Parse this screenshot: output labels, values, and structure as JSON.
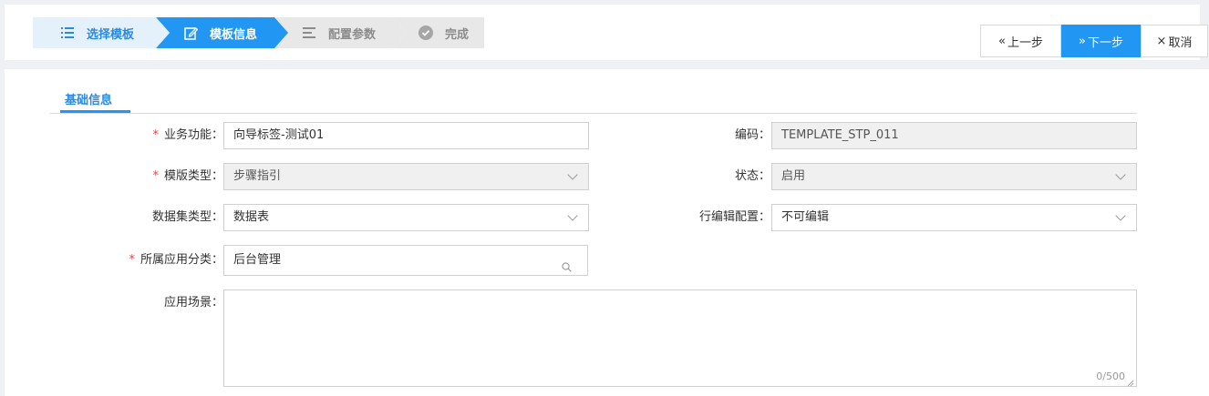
{
  "steps": [
    {
      "label": "选择模板",
      "icon": "list-icon",
      "state": "done"
    },
    {
      "label": "模板信息",
      "icon": "edit-icon",
      "state": "active"
    },
    {
      "label": "配置参数",
      "icon": "lines-icon",
      "state": "pending"
    },
    {
      "label": "完成",
      "icon": "check-circle-icon",
      "state": "pending"
    }
  ],
  "toolbar": {
    "prev_label": "上一步",
    "next_label": "下一步",
    "cancel_label": "取消",
    "prev_icon": "«",
    "next_icon": "»",
    "cancel_icon": "×"
  },
  "tabs": {
    "basic_info": "基础信息"
  },
  "form": {
    "business_function": {
      "label": "业务功能：",
      "value": "向导标签-测试01",
      "required": true
    },
    "code": {
      "label": "编码：",
      "value": "TEMPLATE_STP_011"
    },
    "template_type": {
      "label": "模版类型：",
      "value": "步骤指引",
      "required": true
    },
    "status": {
      "label": "状态：",
      "value": "启用"
    },
    "dataset_type": {
      "label": "数据集类型：",
      "value": "数据表"
    },
    "row_edit_config": {
      "label": "行编辑配置：",
      "value": "不可编辑"
    },
    "app_category": {
      "label": "所属应用分类：",
      "value": "后台管理",
      "required": true
    },
    "scenario": {
      "label": "应用场景：",
      "value": "",
      "counter": "0/500"
    },
    "required_mark": "*"
  },
  "colors": {
    "primary": "#2196f3",
    "required": "#e64545"
  }
}
